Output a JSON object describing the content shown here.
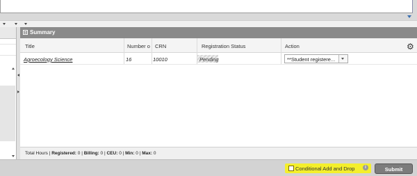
{
  "summary_panel": {
    "title": "Summary",
    "columns": [
      "Title",
      "Number o",
      "CRN",
      "Registration Status",
      "Action"
    ],
    "rows": [
      {
        "title": "Agroecology Science",
        "number": "16",
        "crn": "10010",
        "status": "Pending",
        "action": "**Student registere..."
      }
    ]
  },
  "footer": {
    "total_hours_label": "Total Hours",
    "registered_label": "Registered:",
    "registered_value": "0",
    "billing_label": "Billing:",
    "billing_value": "0",
    "ceu_label": "CEU:",
    "ceu_value": "0",
    "min_label": "Min:",
    "min_value": "0",
    "max_label": "Max:",
    "max_value": "0"
  },
  "bottom_bar": {
    "conditional_label": "Conditional Add and Drop",
    "info_icon": "i",
    "submit_label": "Submit"
  }
}
